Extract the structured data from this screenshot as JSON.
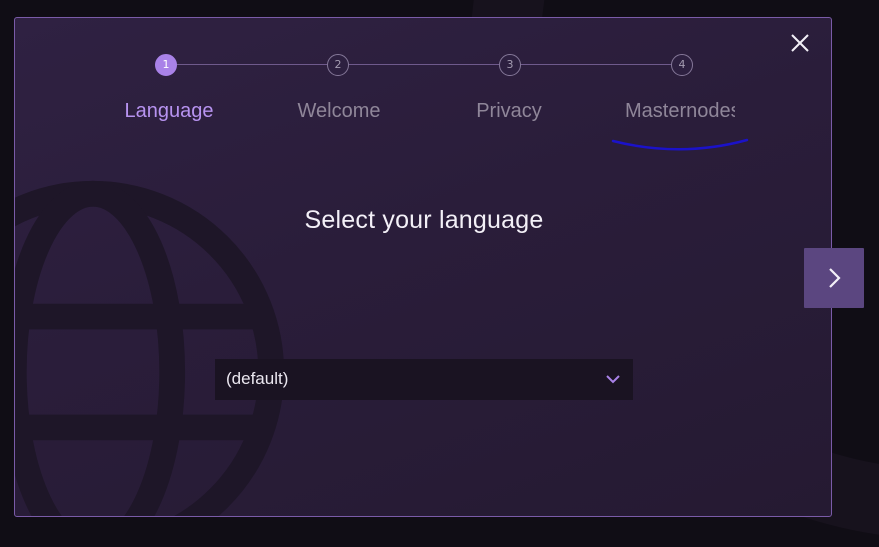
{
  "wizard": {
    "steps": [
      {
        "number": "1",
        "label": "Language"
      },
      {
        "number": "2",
        "label": "Welcome"
      },
      {
        "number": "3",
        "label": "Privacy"
      },
      {
        "number": "4",
        "label": "Masternodes"
      }
    ],
    "active_step": 1,
    "accent_color": "#a982e8",
    "highlight_stroke_color": "#1b12c9"
  },
  "main": {
    "heading": "Select your language",
    "language_select": {
      "selected": "(default)"
    }
  },
  "icons": {
    "close": "close-icon",
    "next": "chevron-right-icon",
    "dropdown": "chevron-down-icon",
    "background": "globe-icon"
  }
}
